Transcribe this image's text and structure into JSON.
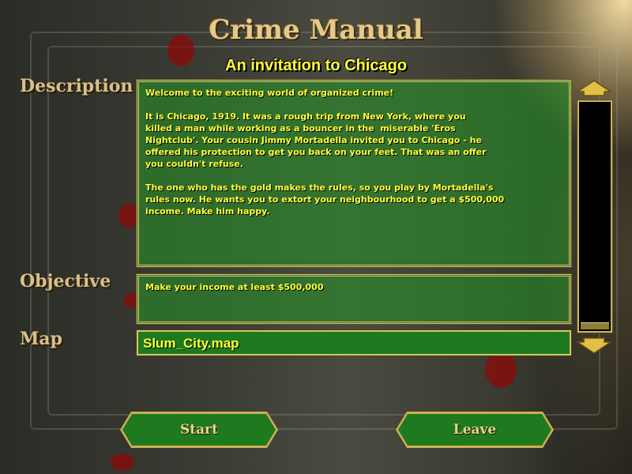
{
  "header": {
    "title": "Crime Manual",
    "subtitle": "An invitation to Chicago"
  },
  "labels": {
    "description": "Description",
    "objective": "Objective",
    "map": "Map"
  },
  "description": {
    "text": "Welcome to the exciting world of organized crime!\n\nIt is Chicago, 1919. It was a rough trip from New York, where you\nkilled a man while working as a bouncer in the  miserable 'Eros\nNightclub'. Your cousin Jimmy Mortadella invited you to Chicago - he\noffered his protection to get you back on your feet. That was an offer\nyou couldn't refuse.\n\nThe one who has the gold makes the rules, so you play by Mortadella's\nrules now. He wants you to extort your neighbourhood to get a $500,000\nincome. Make him happy."
  },
  "objective": {
    "text": "Make your income at least $500,000"
  },
  "map": {
    "value": "Slum_City.map"
  },
  "buttons": {
    "start": "Start",
    "leave": "Leave"
  },
  "scrollbar": {
    "up_icon": "arrow-up-icon",
    "down_icon": "arrow-down-icon",
    "position": 1.0
  },
  "colors": {
    "text_yellow": "#ffff3a",
    "panel_green": "#289028",
    "frame_gold": "#d6c36a",
    "label_tan": "#d9c08a"
  }
}
